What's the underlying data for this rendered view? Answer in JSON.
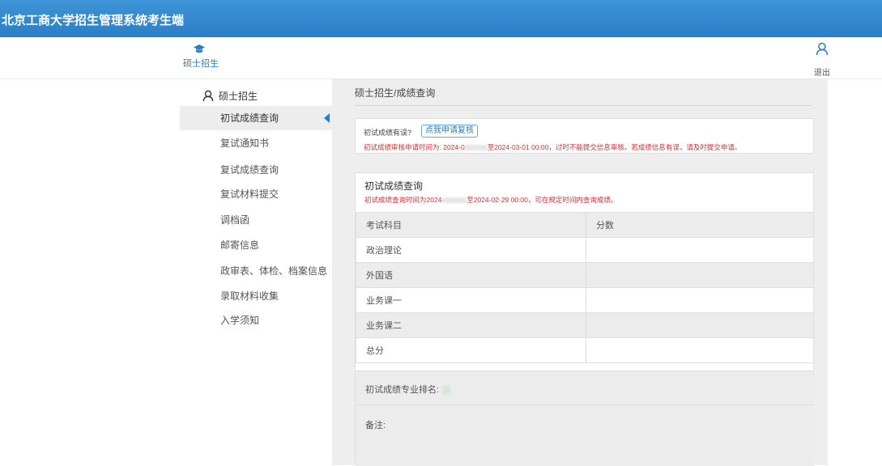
{
  "header": {
    "title": "北京工商大学招生管理系统考生端"
  },
  "nav": {
    "tab_label": "硕士招生",
    "logout_label": "退出"
  },
  "sidebar": {
    "heading": "硕士招生",
    "items": [
      {
        "label": "初试成绩查询",
        "active": true
      },
      {
        "label": "复试通知书"
      },
      {
        "label": "复试成绩查询"
      },
      {
        "label": "复试材料提交"
      },
      {
        "label": "调档函"
      },
      {
        "label": "邮寄信息"
      },
      {
        "label": "政审表、体检、档案信息"
      },
      {
        "label": "录取材料收集"
      },
      {
        "label": "入学须知"
      }
    ]
  },
  "main": {
    "breadcrumb": "硕士招生/成绩查询",
    "notice": {
      "question": "初试成绩有误?",
      "button": "点我申请复核",
      "text_a": "初试成绩审核申请时间为: 2024-0",
      "text_b": "至2024-03-01 00:00，过时不能提交信息审核。若成绩信息有误，请及时提交申请。"
    },
    "panel": {
      "title": "初试成绩查询",
      "sub_a": "初试成绩查询时间为2024-",
      "sub_b": "至2024-02-29 00:00，可在规定时间内查询成绩。",
      "table_headers": [
        "考试科目",
        "分数"
      ],
      "rows": [
        {
          "subject": "政治理论",
          "score": ""
        },
        {
          "subject": "外国语",
          "score": ""
        },
        {
          "subject": "业务课一",
          "score": ""
        },
        {
          "subject": "业务课二",
          "score": ""
        },
        {
          "subject": "总分",
          "score": ""
        }
      ],
      "rank_label": "初试成绩专业排名:",
      "note_label": "备注:"
    }
  },
  "colors": {
    "brand_blue": "#2a7ec6",
    "warning_red": "#d43030"
  }
}
